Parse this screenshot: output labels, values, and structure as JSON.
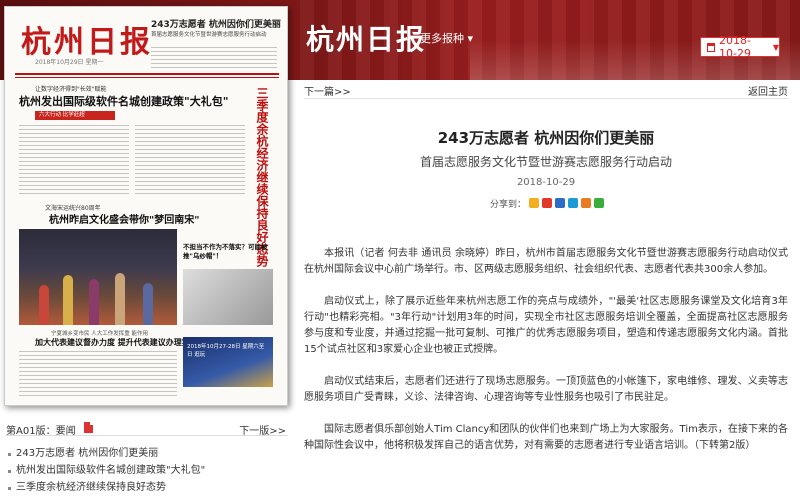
{
  "header": {
    "brand": "杭州日报",
    "more_sites": "更多报种",
    "date": "2018-10-29",
    "colors": {
      "banner": "#7b1717",
      "accent": "#d22222"
    }
  },
  "paper": {
    "masthead": "杭州日报",
    "masthead_date": "2018年10月29日 星期一",
    "top_headline": "243万志愿者 杭州因你们更美丽",
    "top_sub": "首届志愿服务文化节暨世游赛志愿服务行动启动",
    "head1_small": "让数字经济得到\"长效\"赋能",
    "head1": "杭州发出国际级软件名城创建政策\"大礼包\"",
    "red_strip": "六大行动 比学赶超",
    "vertical": "三季度余杭经济继续保持良好态势",
    "head2_small": "文海宋运统兴80周年",
    "head2": "杭州昨启文化盛会带你\"梦回南宋\"",
    "side_question": "不担当不作为不落实？可能被推\"乌纱帽\"！",
    "head3_small": "宁夏城乡变市民 人大工作发挥重 能作用",
    "head3": "加大代表建议督办力度 提升代表建议办理实效",
    "ad_text": "2018年10月27-28日 星期六至日 逛玩"
  },
  "left_nav": {
    "current_page": "第A01版：要闻",
    "next_page": "下一版>>"
  },
  "articles": [
    "243万志愿者 杭州因你们更美丽",
    "杭州发出国际级软件名城创建政策\"大礼包\"",
    "三季度余杭经济继续保持良好态势"
  ],
  "content": {
    "prev_link": "下一篇>>",
    "back_link": "返回主页",
    "title": "243万志愿者 杭州因你们更美丽",
    "subtitle": "首届志愿服务文化节暨世游赛志愿服务行动启动",
    "date": "2018-10-29",
    "share_label": "分享到：",
    "share_icons": [
      "qzone-icon",
      "weibo-icon",
      "renren-icon",
      "qq-icon",
      "kaixin-icon",
      "wechat-icon"
    ],
    "paragraphs": [
      "本报讯（记者 何去非 通讯员 余晓婷）昨日，杭州市首届志愿服务文化节暨世游赛志愿服务行动启动仪式在杭州国际会议中心前广场举行。市、区两级志愿服务组织、社会组织代表、志愿者代表共300余人参加。",
      "启动仪式上，除了展示近些年来杭州志愿工作的亮点与成绩外，\"'最美'社区志愿服务课堂及文化培育3年行动\"也精彩亮相。\"3年行动\"计划用3年的时间，实现全市社区志愿服务培训全覆盖，全面提高社区志愿服务参与度和专业度，并通过挖掘一批可复制、可推广的优秀志愿服务项目，塑造和传递志愿服务文化内涵。首批15个试点社区和3家爱心企业也被正式授牌。",
      "启动仪式结束后，志愿者们还进行了现场志愿服务。一顶顶蓝色的小帐篷下，家电维修、理发、义卖等志愿服务项目广受青睐，义诊、法律咨询、心理咨询等专业性服务也吸引了市民驻足。",
      "国际志愿者俱乐部创始人Tim Clancy和团队的伙伴们也来到广场上为大家服务。Tim表示，在接下来的各种国际性会议中，他将积极发挥自己的语言优势，对有需要的志愿者进行专业语言培训。（下转第2版）"
    ]
  }
}
